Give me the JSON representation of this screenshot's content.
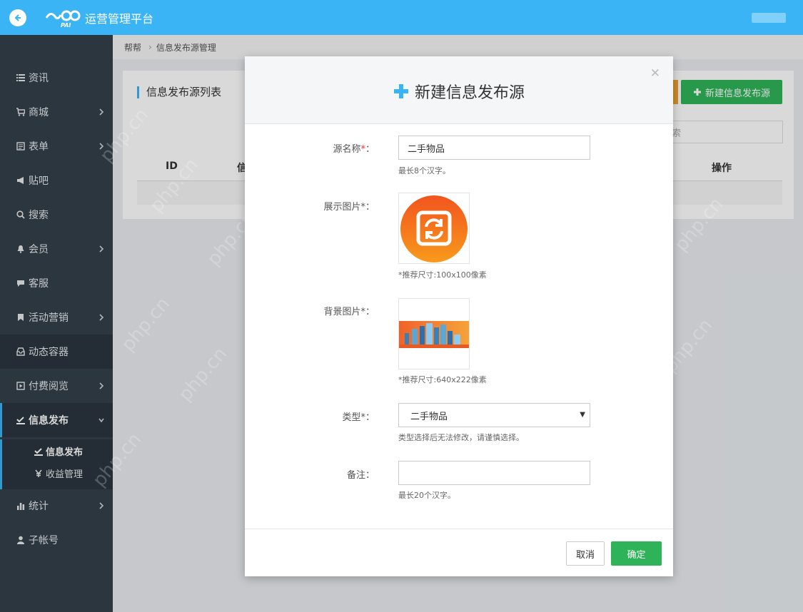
{
  "header": {
    "app_title": "运营管理平台",
    "logo_text": "PAI"
  },
  "sidebar": {
    "items": [
      {
        "label": "资讯",
        "icon": "list-icon"
      },
      {
        "label": "商城",
        "icon": "cart-icon"
      },
      {
        "label": "表单",
        "icon": "form-icon"
      },
      {
        "label": "贴吧",
        "icon": "megaphone-icon"
      },
      {
        "label": "搜索",
        "icon": "search-icon"
      },
      {
        "label": "会员",
        "icon": "bell-icon"
      },
      {
        "label": "客服",
        "icon": "chat-icon"
      },
      {
        "label": "活动营销",
        "icon": "bookmark-icon"
      },
      {
        "label": "动态容器",
        "icon": "inbox-icon"
      },
      {
        "label": "付费阅览",
        "icon": "play-icon"
      },
      {
        "label": "信息发布",
        "icon": "check-edit-icon"
      },
      {
        "label": "统计",
        "icon": "bar-chart-icon"
      },
      {
        "label": "子帐号",
        "icon": "user-icon"
      }
    ],
    "subitems": [
      {
        "label": "信息发布"
      },
      {
        "label": "收益管理"
      }
    ]
  },
  "breadcrumb": {
    "home": "帮帮",
    "current": "信息发布源管理"
  },
  "panel": {
    "title": "信息发布源列表",
    "new_button": "新建信息发布源",
    "search_placeholder": "索",
    "col_id": "ID",
    "col_info": "信",
    "col_op": "操作"
  },
  "modal": {
    "title": "新建信息发布源",
    "name_label": "源名称",
    "name_value": "二手物品",
    "name_help": "最长8个汉字。",
    "display_label": "展示图片",
    "display_help": "*推荐尺寸:100x100像素",
    "bg_label": "背景图片",
    "bg_help": "*推荐尺寸:640x222像素",
    "type_label": "类型",
    "type_value": "二手物品",
    "type_help": "类型选择后无法修改，请谨慎选择。",
    "remark_label": "备注",
    "remark_value": "",
    "remark_help": "最长20个汉字。",
    "required_mark": "*",
    "colon": "：",
    "cancel": "取消",
    "confirm": "确定"
  },
  "watermark": "php.cn",
  "colors": {
    "topbar": "#3ab4f5",
    "sidebar": "#34404b",
    "accent_green": "#2fb359",
    "accent_orange": "#f0a030",
    "required_red": "#e33333"
  }
}
